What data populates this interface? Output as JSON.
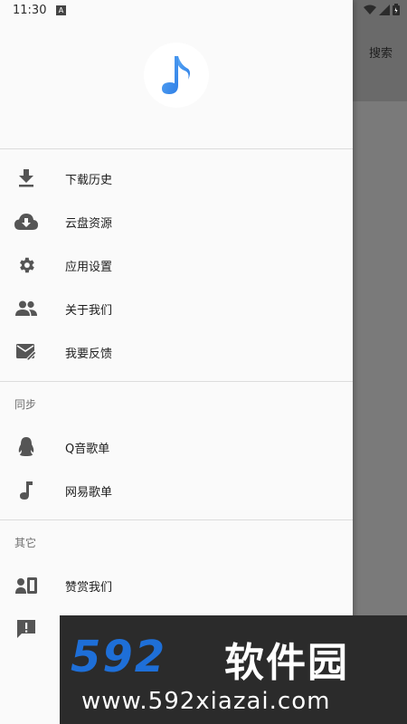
{
  "status_bar": {
    "time": "11:30",
    "notification_badge": "A"
  },
  "background_app": {
    "search_label": "搜索"
  },
  "drawer": {
    "logo_icon": "music-note-icon",
    "accent_color": "#3d8ff2",
    "main_items": [
      {
        "label": "下载历史",
        "icon": "download-icon"
      },
      {
        "label": "云盘资源",
        "icon": "cloud-download-icon"
      },
      {
        "label": "应用设置",
        "icon": "gear-icon"
      },
      {
        "label": "关于我们",
        "icon": "people-icon"
      },
      {
        "label": "我要反馈",
        "icon": "feedback-mail-icon"
      }
    ],
    "sync_section": {
      "header": "同步",
      "items": [
        {
          "label": "Q音歌单",
          "icon": "qq-penguin-icon"
        },
        {
          "label": "网易歌单",
          "icon": "music-note-icon"
        }
      ]
    },
    "other_section": {
      "header": "其它",
      "items": [
        {
          "label": "赞赏我们",
          "icon": "donate-icon"
        },
        {
          "label": "",
          "icon": "report-icon"
        }
      ]
    }
  },
  "watermark": {
    "logo_text": "592",
    "cn_text": "软件园",
    "url": "www.592xiazai.com"
  }
}
